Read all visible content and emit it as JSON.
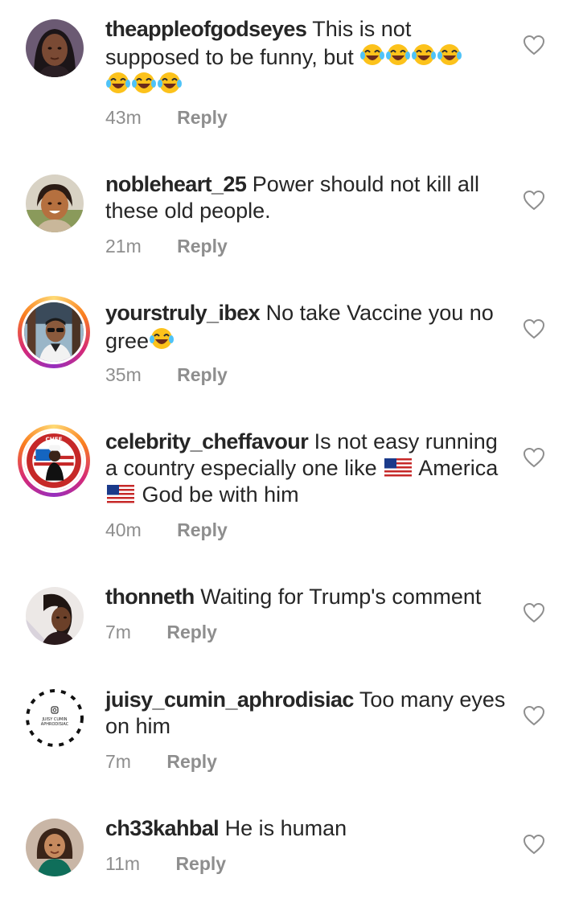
{
  "comments": [
    {
      "username": "theappleofgodseyes",
      "text": "This is not supposed to be funny, but",
      "emoji_line1": "😂😂😂😂",
      "emoji_line2": "😂😂😂",
      "time": "43m",
      "reply": "Reply",
      "avatar_icon": "avatar-dark-hair-woman"
    },
    {
      "username": "nobleheart_25",
      "text": "Power should not kill all these old people.",
      "time": "21m",
      "reply": "Reply",
      "avatar_icon": "avatar-smiling-woman"
    },
    {
      "username": "yourstruly_ibex",
      "text": "No take Vaccine you no gree",
      "emoji": "😂",
      "time": "35m",
      "reply": "Reply",
      "avatar_icon": "avatar-man-sunglasses",
      "story_ring": true
    },
    {
      "username": "celebrity_cheffavour",
      "text_part1": "Is not easy running a country especially one like",
      "text_part2": "America",
      "text_part3": "God be with him",
      "flag": "🇺🇸",
      "time": "40m",
      "reply": "Reply",
      "avatar_icon": "avatar-chef-logo",
      "story_ring": true
    },
    {
      "username": "thonneth",
      "text": "Waiting for Trump's comment",
      "time": "7m",
      "reply": "Reply",
      "avatar_icon": "avatar-woman-portrait"
    },
    {
      "username": "juisy_cumin_aphrodisiac",
      "text": "Too many eyes on him",
      "time": "7m",
      "reply": "Reply",
      "avatar_icon": "avatar-logo-badge"
    },
    {
      "username": "ch33kahbal",
      "text": "He is human",
      "time": "11m",
      "reply": "Reply",
      "avatar_icon": "avatar-woman-green-top"
    }
  ],
  "colors": {
    "text": "#262626",
    "meta": "#8e8e8e",
    "heart_stroke": "#8e8e8e"
  },
  "icons": {
    "like": "heart-outline-icon"
  }
}
